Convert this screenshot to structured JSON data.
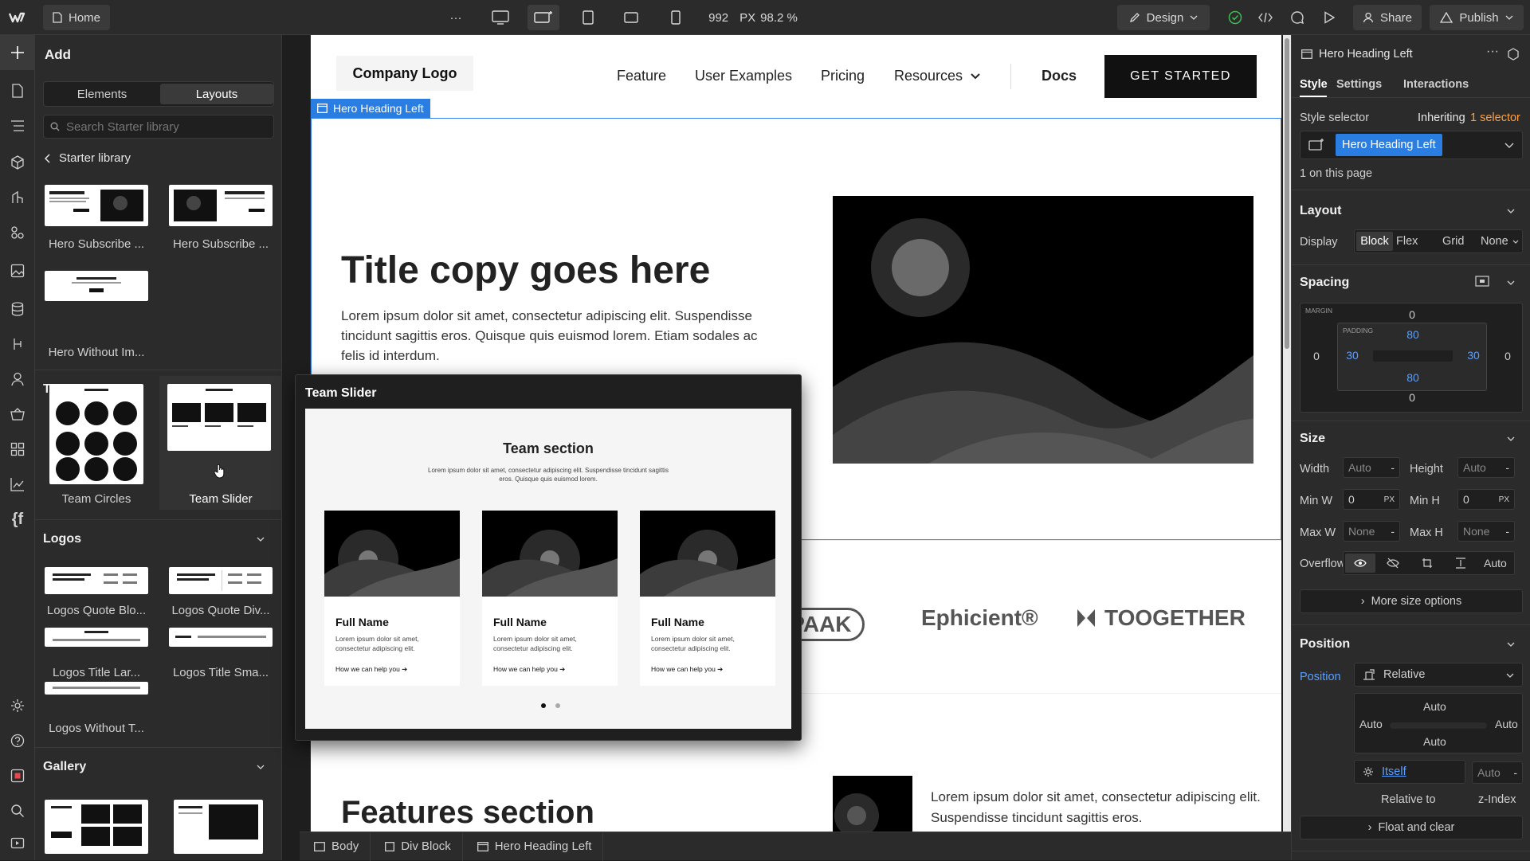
{
  "topbar": {
    "home": "Home",
    "more": "···",
    "width_value": "992",
    "width_unit": "PX",
    "zoom": "98.2 %",
    "design": "Design",
    "share": "Share",
    "publish": "Publish"
  },
  "add_panel": {
    "title": "Add",
    "tabs": [
      "Elements",
      "Layouts"
    ],
    "active_tab": "Layouts",
    "search_placeholder": "Search Starter library",
    "back_label": "Starter library",
    "top_items": [
      "Hero Subscribe ...",
      "Hero Subscribe ...",
      "Hero Without Im..."
    ],
    "team": {
      "title": "Team",
      "items": [
        "Team Circles",
        "Team Slider"
      ]
    },
    "logos": {
      "title": "Logos",
      "items": [
        "Logos Quote Blo...",
        "Logos Quote Div...",
        "Logos Title Lar...",
        "Logos Title Sma...",
        "Logos Without T..."
      ]
    },
    "gallery": {
      "title": "Gallery"
    },
    "thumb_text": "Title copy goes here"
  },
  "page": {
    "nav_logo": "Company Logo",
    "nav_links": [
      "Feature",
      "User Examples",
      "Pricing",
      "Resources",
      "Docs"
    ],
    "cta": "GET STARTED",
    "selection_tag": "Hero Heading Left",
    "hero_title": "Title copy goes here",
    "hero_text": "Lorem ipsum dolor sit amet, consectetur adipiscing elit. Suspendisse tincidunt sagittis eros. Quisque quis euismod lorem. Etiam sodales ac felis id interdum.",
    "logos": [
      "HE·PAAK",
      "Ephicient®",
      "TOOGETHER"
    ],
    "features_title": "Features section",
    "features_text": "Lorem ipsum dolor sit amet, consectetur adipiscing elit. Suspendisse tincidunt sagittis eros."
  },
  "popup": {
    "title": "Team Slider",
    "section_title": "Team section",
    "section_text": "Lorem ipsum dolor sit amet, consectetur adipiscing elit. Suspendisse tincidunt sagittis eros. Quisque quis euismod lorem.",
    "cards": [
      {
        "name": "Full Name",
        "desc": "Lorem ipsum dolor sit amet, consectetur adipiscing elit.",
        "link": "How we can help you ➔"
      },
      {
        "name": "Full Name",
        "desc": "Lorem ipsum dolor sit amet, consectetur adipiscing elit.",
        "link": "How we can help you ➔"
      },
      {
        "name": "Full Name",
        "desc": "Lorem ipsum dolor sit amet, consectetur adipiscing elit.",
        "link": "How we can help you ➔"
      }
    ]
  },
  "breadcrumbs": [
    "Body",
    "Div Block",
    "Hero Heading Left"
  ],
  "right_panel": {
    "element": "Hero Heading Left",
    "tabs": [
      "Style",
      "Settings",
      "Interactions"
    ],
    "style_selector_label": "Style selector",
    "inheriting": "Inheriting",
    "inherit_count": "1 selector",
    "selector_chip": "Hero Heading Left",
    "on_page": "1 on this page",
    "layout": {
      "title": "Layout",
      "display_label": "Display",
      "options": [
        "Block",
        "Flex",
        "Grid",
        "None"
      ]
    },
    "spacing": {
      "title": "Spacing",
      "margin_label": "MARGIN",
      "padding_label": "PADDING",
      "margin": {
        "top": "0",
        "right": "0",
        "bottom": "0",
        "left": "0"
      },
      "padding": {
        "top": "80",
        "right": "30",
        "bottom": "80",
        "left": "30"
      }
    },
    "size": {
      "title": "Size",
      "width_label": "Width",
      "width": "Auto",
      "height_label": "Height",
      "height": "Auto",
      "minw_label": "Min W",
      "minw": "0",
      "minw_unit": "PX",
      "minh_label": "Min H",
      "minh": "0",
      "minh_unit": "PX",
      "maxw_label": "Max W",
      "maxw": "None",
      "maxh_label": "Max H",
      "maxh": "None",
      "overflow_label": "Overflow",
      "overflow_auto": "Auto",
      "more": "More size options"
    },
    "position": {
      "title": "Position",
      "label": "Position",
      "value": "Relative",
      "top": "Auto",
      "left": "Auto",
      "right": "Auto",
      "bottom": "Auto",
      "relative_value": "Itself",
      "relative_label": "Relative to",
      "z_value": "Auto",
      "z_label": "z-Index",
      "float": "Float and clear"
    }
  }
}
